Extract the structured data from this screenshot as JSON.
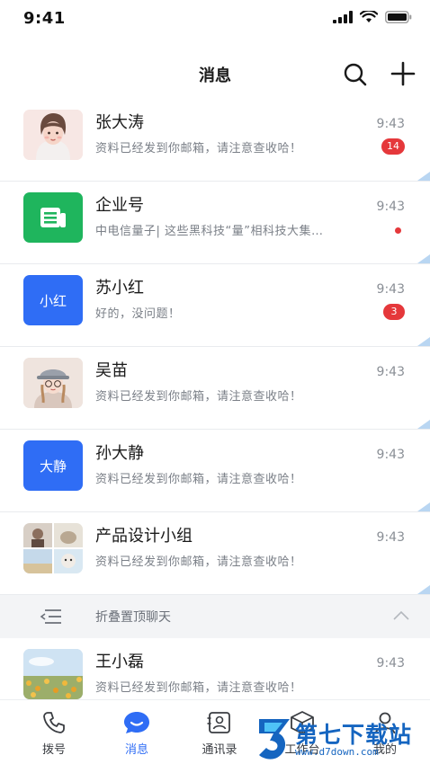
{
  "status_bar": {
    "time": "9:41"
  },
  "header": {
    "title": "消息"
  },
  "chats": [
    {
      "name": "张大涛",
      "preview": "资料已经发到你邮箱，请注意查收哈！",
      "time": "9:43",
      "badge": "14",
      "avatar_type": "girl-illustration"
    },
    {
      "name": "企业号",
      "preview": "中电信量子| 这些黑科技“量”相科技大集…",
      "time": "9:43",
      "unread_dot": true,
      "avatar_type": "green-document-icon",
      "avatar_color": "#1fb55d"
    },
    {
      "name": "苏小红",
      "preview": "好的，没问题！",
      "time": "9:43",
      "badge": "3",
      "avatar_text": "小红",
      "avatar_color": "#2f6df5"
    },
    {
      "name": "吴苗",
      "preview": "资料已经发到你邮箱，请注意查收哈！",
      "time": "9:43",
      "avatar_type": "girl-with-hat-illustration"
    },
    {
      "name": "孙大静",
      "preview": "资料已经发到你邮箱，请注意查收哈！",
      "time": "9:43",
      "avatar_text": "大静",
      "avatar_color": "#2f6df5"
    },
    {
      "name": "产品设计小组",
      "preview": "资料已经发到你邮箱，请注意查收哈！",
      "time": "9:43",
      "avatar_type": "group-photo-grid"
    }
  ],
  "fold_bar": {
    "label": "折叠置顶聊天"
  },
  "unpinned_chats": [
    {
      "name": "王小磊",
      "preview": "资料已经发到你邮箱，请注意查收哈！",
      "time": "9:43",
      "avatar_type": "flower-field-photo"
    }
  ],
  "tabs": [
    {
      "label": "拨号",
      "icon": "phone-icon"
    },
    {
      "label": "消息",
      "icon": "chat-bubble-icon",
      "active": true
    },
    {
      "label": "通讯录",
      "icon": "contacts-icon"
    },
    {
      "label": "工作台",
      "icon": "cube-icon"
    },
    {
      "label": "我的",
      "icon": "person-icon"
    }
  ],
  "watermark": {
    "title": "第七下载站",
    "url": "www.d7down.com"
  },
  "colors": {
    "accent": "#2f6df5",
    "badge": "#e5383b",
    "green": "#1fb55d",
    "pin_corner": "#b9d6f2"
  }
}
